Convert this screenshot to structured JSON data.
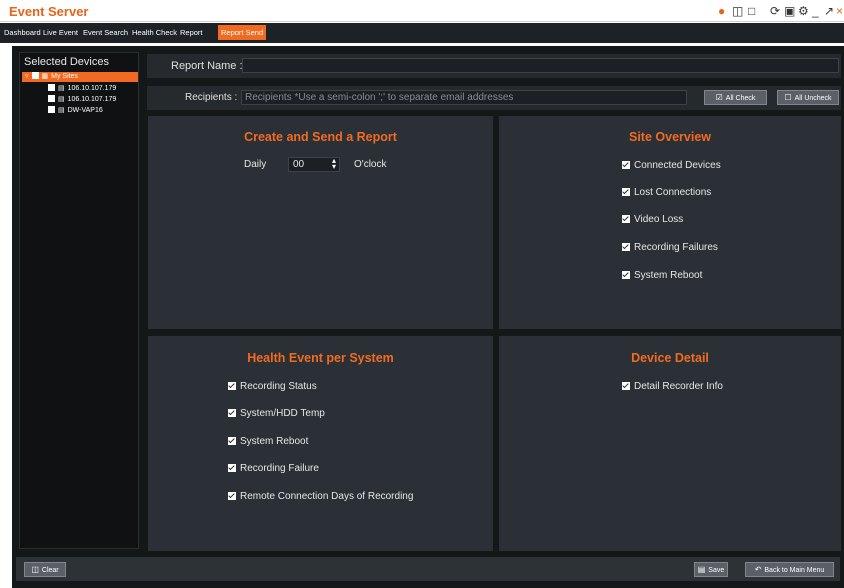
{
  "app": {
    "title": "Event Server",
    "window_icons": [
      "logo-icon",
      "layout-icon",
      "window-icon",
      "refresh-icon",
      "lock-icon",
      "settings-icon",
      "minimize-icon",
      "maximize-icon",
      "close-icon"
    ]
  },
  "tabs": [
    {
      "label": "Dashboard",
      "active": false
    },
    {
      "label": "Live Event",
      "active": false
    },
    {
      "label": "Event Search",
      "active": false
    },
    {
      "label": "Health Check",
      "active": false
    },
    {
      "label": "Report",
      "active": false
    },
    {
      "label": "Report Send",
      "active": true
    }
  ],
  "sidebar": {
    "title": "Selected Devices",
    "root": {
      "label": "My Sites",
      "checked": false
    },
    "devices": [
      {
        "label": "106.10.107.179"
      },
      {
        "label": "106.10.107.179"
      },
      {
        "label": "DW-VAP16"
      }
    ]
  },
  "report": {
    "name_label": "Report Name :",
    "name_value": "",
    "recipients_label": "Recipients :",
    "recipients_placeholder": "Recipients *Use a semi-colon ';' to separate email addresses",
    "all_check_label": "All Check",
    "all_uncheck_label": "All Uncheck"
  },
  "create_send": {
    "title": "Create and Send a Report",
    "daily_label": "Daily",
    "hour_value": "00",
    "oclock_label": "O'clock"
  },
  "site_overview": {
    "title": "Site Overview",
    "items": [
      "Connected Devices",
      "Lost Connections",
      "Video Loss",
      "Recording Failures",
      "System Reboot"
    ]
  },
  "health_event": {
    "title": "Health Event per System",
    "items": [
      "Recording Status",
      "System/HDD Temp",
      "System Reboot",
      "Recording Failure",
      "Remote Connection Days of Recording"
    ]
  },
  "device_detail": {
    "title": "Device Detail",
    "items": [
      "Detail Recorder Info"
    ]
  },
  "footer": {
    "clear_label": "Clear",
    "save_label": "Save",
    "back_label": "Back to Main Menu"
  },
  "colors": {
    "accent": "#f26a21",
    "panel": "#2a3035",
    "background": "#151819"
  }
}
